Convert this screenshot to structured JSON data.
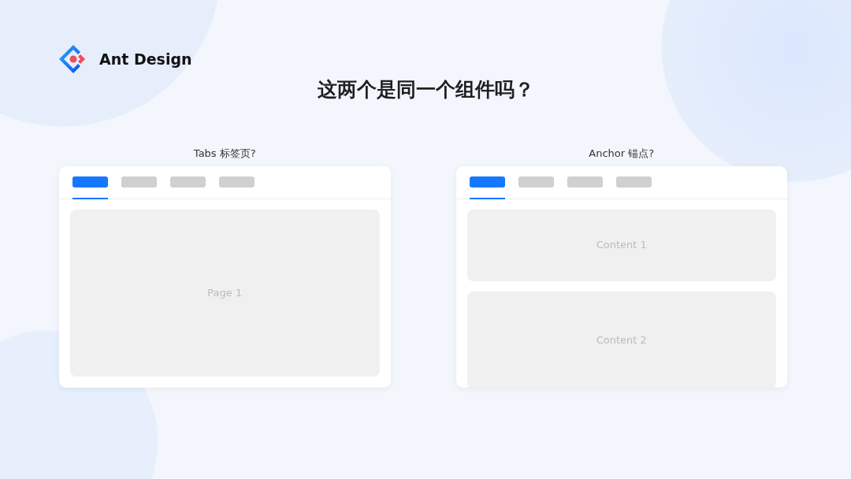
{
  "brand": {
    "name": "Ant Design"
  },
  "title": "这两个是同一个组件吗？",
  "panels": [
    {
      "caption": "Tabs 标签页?",
      "tabs": [
        {
          "selected": true
        },
        {
          "selected": false
        },
        {
          "selected": false
        },
        {
          "selected": false
        }
      ],
      "blocks": [
        {
          "label": "Page 1"
        }
      ]
    },
    {
      "caption": "Anchor 锚点?",
      "tabs": [
        {
          "selected": true
        },
        {
          "selected": false
        },
        {
          "selected": false
        },
        {
          "selected": false
        }
      ],
      "blocks": [
        {
          "label": "Content 1"
        },
        {
          "label": "Content 2"
        }
      ]
    }
  ]
}
